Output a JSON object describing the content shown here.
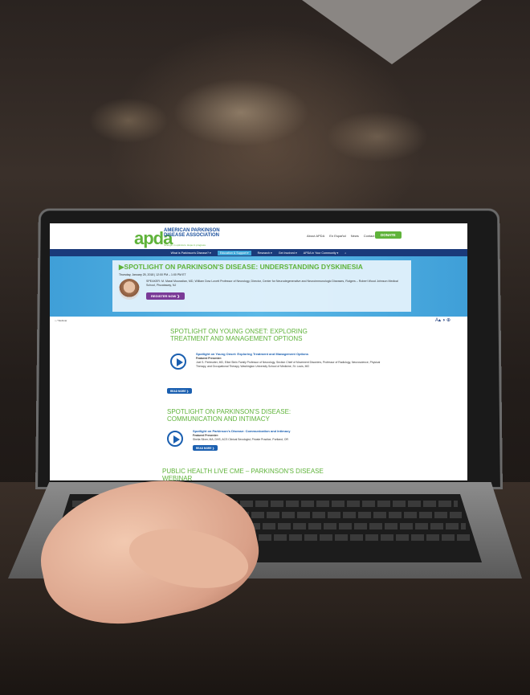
{
  "site": {
    "logo_text": "apda",
    "org_name": "AMERICAN PARKINSON DISEASE ASSOCIATION",
    "tagline": "Strength in optimism. Hope in progress.",
    "top_links": [
      "About APDA",
      "En Español",
      "News",
      "Contact"
    ],
    "donate_label": "DONATE",
    "nav": [
      "What is Parkinson's Disease? ▾",
      "Education & Support ▾",
      "Research ▾",
      "Get Involved ▾",
      "APDA in Your Community ▾",
      "⌕"
    ],
    "nav_active_index": 1
  },
  "hero": {
    "title": "▶SPOTLIGHT ON PARKINSON'S DISEASE: UNDERSTANDING DYSKINESIA",
    "date": "Thursday, January 25, 2018 | 12:00 PM – 1:00 PM ET",
    "speaker": "SPEAKER: M. Maral Mouradian, MD, William Dow Lovett Professor of Neurology, Director, Center for Neurodegenerative and Neuroimmunologic Diseases, Rutgers – Robert Wood Johnson Medical School, Piscataway, NJ",
    "register_label": "REGISTER NOW ❯"
  },
  "breadcrumb": "⌂ / Webinar",
  "accessibility_icons": "A▴ ◑ ⊕",
  "webinars": [
    {
      "heading": "SPOTLIGHT ON YOUNG ONSET: EXPLORING TREATMENT AND MANAGEMENT OPTIONS",
      "video_title": "Spotlight on Young Onset: Exploring Treatment and Management Options",
      "presenter_label": "Featured Presenter:",
      "presenter": "Joel S. Perlmutter, MD, Elliot Stein Family Professor of Neurology, Section Chief of Movement Disorders, Professor of Radiology, Neuroscience, Physical Therapy, and Occupational Therapy, Washington University School of Medicine, St. Louis, MO",
      "read_more": "READ MORE ❯"
    },
    {
      "heading": "SPOTLIGHT ON PARKINSON'S DISEASE: COMMUNICATION AND INTIMACY",
      "video_title": "Spotlight on Parkinson's Disease: Communication and Intimacy",
      "presenter_label": "Featured Presenter:",
      "presenter": "Sheila Silver, MA, DHS, ACS Clinical Sexologist, Private Practice, Portland, OR",
      "read_more": "READ MORE ❯"
    },
    {
      "heading": "PUBLIC HEALTH LIVE CME – PARKINSON'S DISEASE WEBINAR"
    }
  ]
}
